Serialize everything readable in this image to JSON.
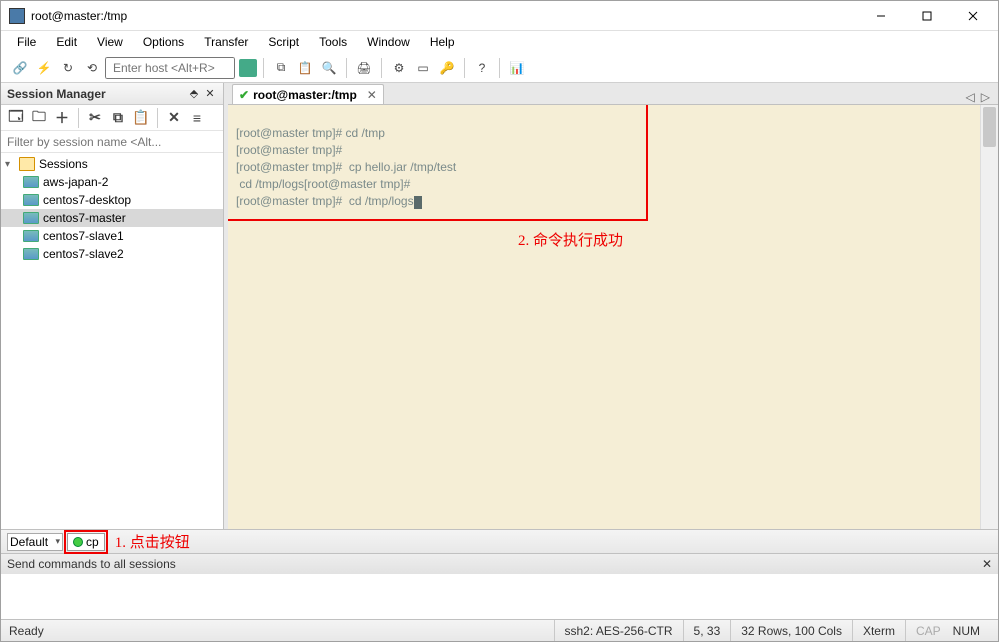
{
  "window": {
    "title": "root@master:/tmp"
  },
  "menus": [
    "File",
    "Edit",
    "View",
    "Options",
    "Transfer",
    "Script",
    "Tools",
    "Window",
    "Help"
  ],
  "host_input": {
    "placeholder": "Enter host <Alt+R>"
  },
  "session_manager": {
    "title": "Session Manager",
    "filter_placeholder": "Filter by session name <Alt...",
    "root": "Sessions",
    "items": [
      "aws-japan-2",
      "centos7-desktop",
      "centos7-master",
      "centos7-slave1",
      "centos7-slave2"
    ],
    "selected": "centos7-master"
  },
  "tab": {
    "title": "root@master:/tmp"
  },
  "terminal_lines": [
    "[root@master tmp]# cd /tmp",
    "[root@master tmp]#",
    "[root@master tmp]#  cp hello.jar /tmp/test",
    " cd /tmp/logs[root@master tmp]#",
    "[root@master tmp]#  cd /tmp/logs"
  ],
  "annotations": {
    "a1": "1. 点击按钮",
    "a2": "2. 命令执行成功"
  },
  "script_bar": {
    "combo": "Default",
    "button": "cp"
  },
  "send_bar": {
    "title": "Send commands to all sessions"
  },
  "status": {
    "ready": "Ready",
    "cipher": "ssh2: AES-256-CTR",
    "pos": "5,  33",
    "size": "32 Rows, 100 Cols",
    "term": "Xterm",
    "cap": "CAP",
    "num": "NUM"
  }
}
